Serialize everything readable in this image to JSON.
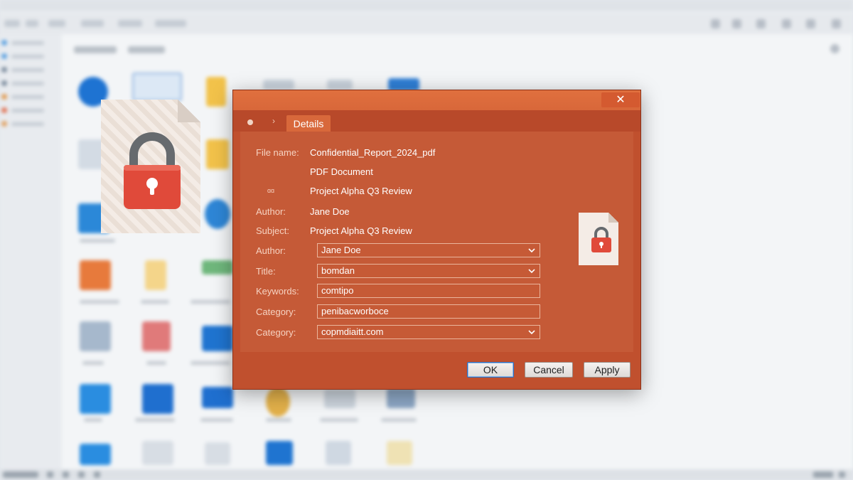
{
  "dialog": {
    "close_glyph": "✕",
    "breadcrumb_chevron": "›",
    "tab_label": "Details",
    "rows": [
      {
        "label": "File name:",
        "value": "Confidential_Report_2024_pdf"
      },
      {
        "label": "",
        "value": "PDF Document"
      },
      {
        "label": "ɑɑ",
        "value": "Project Alpha Q3 Review"
      },
      {
        "label": "Author:",
        "value": "Jane Doe"
      },
      {
        "label": "Subject:",
        "value": "Project Alpha Q3 Review"
      }
    ],
    "fields": [
      {
        "label": "Author:",
        "value": "Jane Doe",
        "dropdown": true
      },
      {
        "label": "Title:",
        "value": "bomdan",
        "dropdown": true
      },
      {
        "label": "Keywords:",
        "value": "comtipo",
        "dropdown": false
      },
      {
        "label": "Category:",
        "value": "penibacworboce",
        "dropdown": false
      },
      {
        "label": "Category:",
        "value": "copmdiaitt.com",
        "dropdown": true
      }
    ],
    "buttons": {
      "ok": "OK",
      "cancel": "Cancel",
      "apply": "Apply"
    }
  },
  "icons": {
    "large_file": "lock-file-icon",
    "small_file": "lock-file-icon",
    "dropdown": "chevron-down-icon",
    "close": "close-icon"
  },
  "colors": {
    "dialog_bg": "#c0502e",
    "titlebar": "#e0703e",
    "lock_red": "#e04a3a",
    "lock_shackle": "#6b6b6b",
    "ok_focus": "#2f6fbf"
  }
}
